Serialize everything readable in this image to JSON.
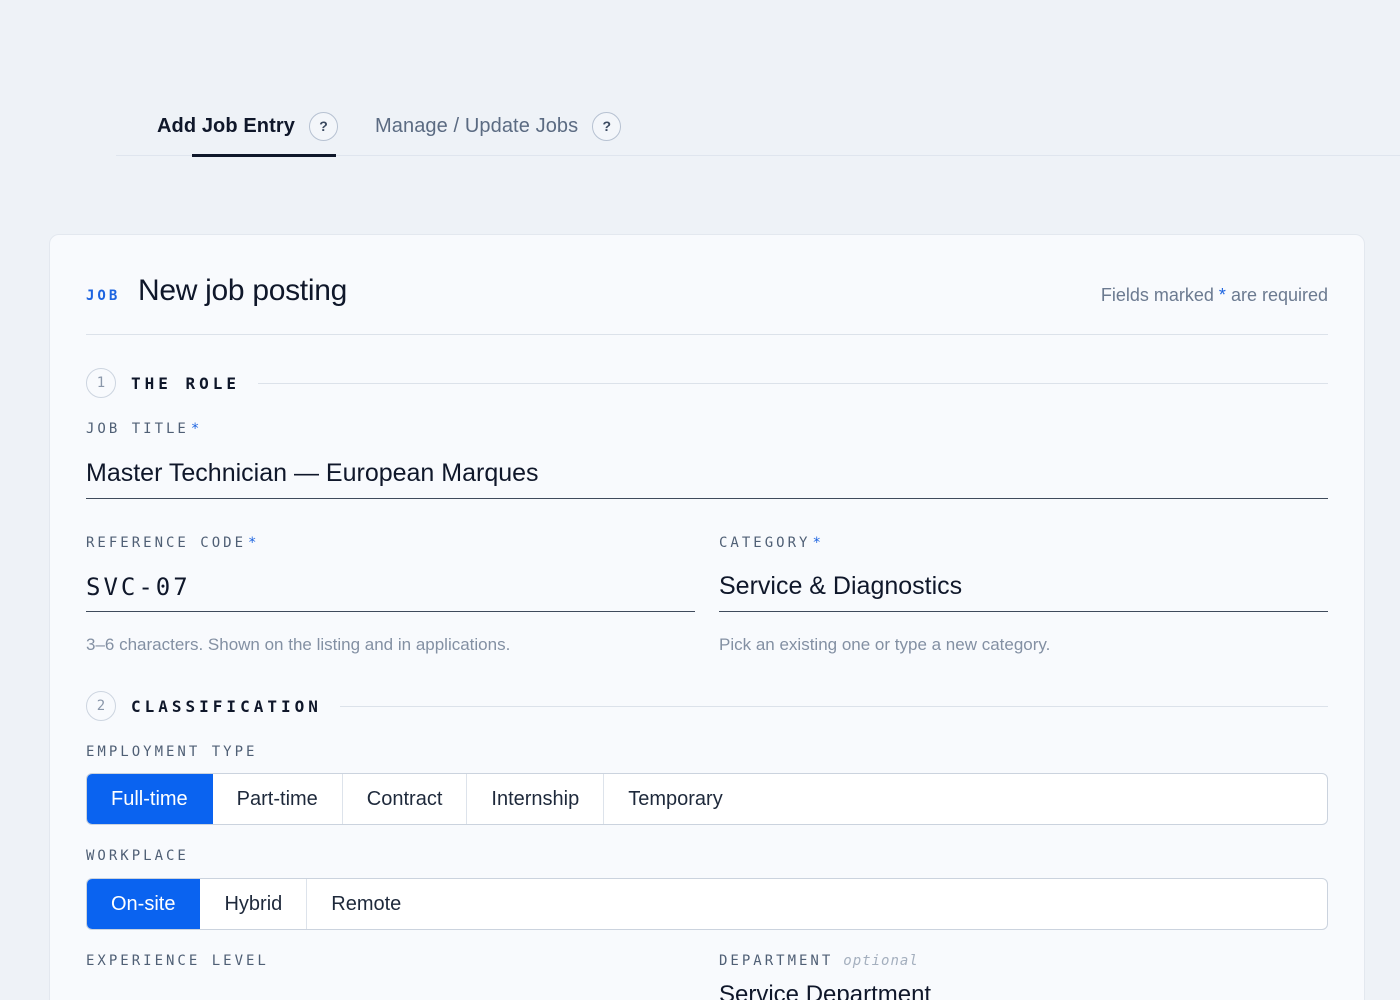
{
  "tabs": [
    {
      "label": "Add Job Entry",
      "help": "?"
    },
    {
      "label": "Manage / Update Jobs",
      "help": "?"
    }
  ],
  "header": {
    "eyebrow": "JOB",
    "title": "New job posting",
    "required_note_prefix": "Fields marked",
    "required_star": "*",
    "required_note_suffix": "are required"
  },
  "sections": [
    {
      "number": "1",
      "title": "THE ROLE"
    },
    {
      "number": "2",
      "title": "CLASSIFICATION"
    }
  ],
  "fields": {
    "job_title": {
      "label": "JOB TITLE",
      "star": "*",
      "value": "Master Technician — European Marques"
    },
    "reference_code": {
      "label": "REFERENCE CODE",
      "star": "*",
      "value": "SVC-07",
      "hint": "3–6 characters. Shown on the listing and in applications."
    },
    "category": {
      "label": "CATEGORY",
      "star": "*",
      "value": "Service & Diagnostics",
      "hint": "Pick an existing one or type a new category."
    },
    "employment_type": {
      "label": "EMPLOYMENT TYPE",
      "options": [
        "Full-time",
        "Part-time",
        "Contract",
        "Internship",
        "Temporary"
      ],
      "selected": "Full-time"
    },
    "workplace": {
      "label": "WORKPLACE",
      "options": [
        "On-site",
        "Hybrid",
        "Remote"
      ],
      "selected": "On-site"
    },
    "experience_level": {
      "label": "EXPERIENCE LEVEL"
    },
    "department": {
      "label": "DEPARTMENT",
      "optional": "optional",
      "value": "Service Department"
    }
  },
  "colors": {
    "accent": "#0a63f0",
    "background": "#eef2f7",
    "card": "#f8fafd"
  }
}
